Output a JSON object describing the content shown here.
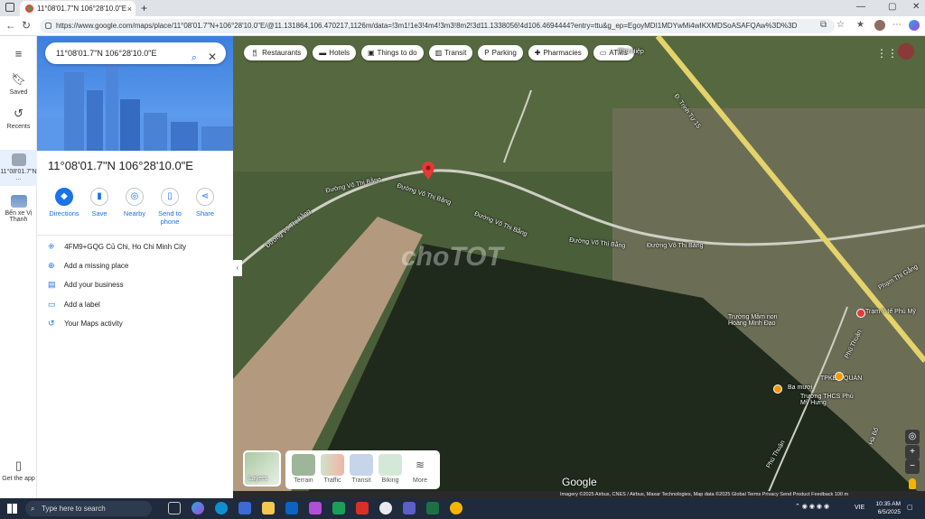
{
  "browser": {
    "tab_title": "11°08'01.7\"N 106°28'10.0\"E - Goo",
    "url": "https://www.google.com/maps/place/11°08'01.7\"N+106°28'10.0\"E/@11.131864,106.470217,1126m/data=!3m1!1e3!4m4!3m3!8m2!3d11.1338056!4d106.4694444?entry=ttu&g_ep=EgoyMDI1MDYwMi4wIKXMDSoASAFQAw%3D%3D",
    "new_tab": "+",
    "close_tab": "×"
  },
  "rail": {
    "menu_icon": "≡",
    "saved": "Saved",
    "recents": "Recents",
    "current_place": "11°08'01.7\"N ...",
    "other_place": "Bến xe Vị Thanh",
    "get_app": "Get the app"
  },
  "panel": {
    "search_value": "11°08'01.7\"N 106°28'10.0\"E",
    "place_title": "11°08'01.7\"N 106°28'10.0\"E",
    "actions": [
      "Directions",
      "Save",
      "Nearby",
      "Send to phone",
      "Share"
    ],
    "plus_code": "4FM9+GQG Củ Chi, Ho Chi Minh City",
    "add_missing_place": "Add a missing place",
    "add_business": "Add your business",
    "add_label": "Add a label",
    "maps_activity": "Your Maps activity"
  },
  "map": {
    "chips": [
      "Restaurants",
      "Hotels",
      "Things to do",
      "Transit",
      "Parking",
      "Pharmacies",
      "ATMs"
    ],
    "road_labels": [
      "Đường Võ Thị Bằng",
      "Đường Võ Thị Bằng",
      "Đường Võ Thị Bằng",
      "Đường Võ Thị Bằng",
      "Đường Võ Thị Bằng",
      "Đường Võ Thị Bằng",
      "Đ. Trịnh Tự 15",
      "Phú Hiệp",
      "Phạm Thị Gẫng",
      "Phú Thuận",
      "Phú Thuận",
      "Hà Bố"
    ],
    "pois": [
      "Trường Mầm non Hoàng Minh Đạo",
      "Trạm Y tế Phú Mỹ",
      "TPKEM QUÁN",
      "Trường THCS Phú Mỹ Hưng",
      "Ba mươi"
    ],
    "watermark": "choTOT",
    "layers_label": "Layers",
    "layer_options": [
      "Terrain",
      "Traffic",
      "Transit",
      "Biking",
      "More"
    ],
    "brand": "Google",
    "footer": "Imagery ©2025 Airbus, CNES / Airbus, Maxar Technologies, Map data ©2025   Global   Terms   Privacy   Send Product Feedback   100 m"
  },
  "taskbar": {
    "search_placeholder": "Type here to search",
    "lang": "VIE",
    "time": "10:35 AM",
    "date": "6/5/2025"
  }
}
